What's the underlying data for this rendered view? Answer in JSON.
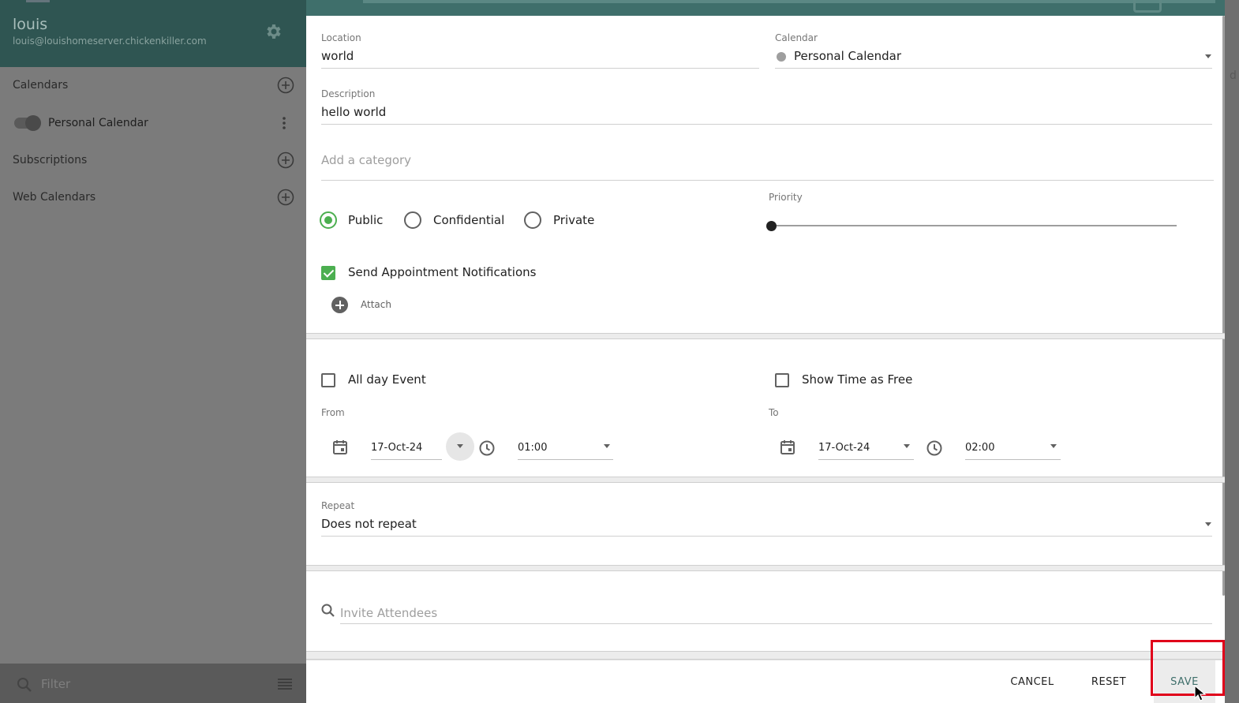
{
  "sidebar": {
    "user_name": "louis",
    "user_email": "louis@louishomeserver.chickenkiller.com",
    "sections": {
      "calendars": "Calendars",
      "personal_calendar": "Personal Calendar",
      "subscriptions": "Subscriptions",
      "web_calendars": "Web Calendars"
    },
    "filter_placeholder": "Filter"
  },
  "dialog": {
    "location": {
      "label": "Location",
      "value": "world"
    },
    "calendar": {
      "label": "Calendar",
      "value": "Personal Calendar"
    },
    "description": {
      "label": "Description",
      "value": "hello world"
    },
    "category_placeholder": "Add a category",
    "visibility": {
      "public": "Public",
      "confidential": "Confidential",
      "private": "Private",
      "selected": "public"
    },
    "priority": {
      "label": "Priority",
      "value": 0
    },
    "send_notifications": {
      "label": "Send Appointment Notifications",
      "checked": true
    },
    "attach_label": "Attach",
    "all_day": {
      "label": "All day Event",
      "checked": false
    },
    "show_free": {
      "label": "Show Time as Free",
      "checked": false
    },
    "from": {
      "label": "From",
      "date": "17-Oct-24",
      "time": "01:00"
    },
    "to": {
      "label": "To",
      "date": "17-Oct-24",
      "time": "02:00"
    },
    "repeat": {
      "label": "Repeat",
      "value": "Does not repeat"
    },
    "invite_placeholder": "Invite Attendees",
    "buttons": {
      "cancel": "CANCEL",
      "reset": "RESET",
      "save": "SAVE"
    }
  },
  "colors": {
    "accent": "#4caf50",
    "header": "#3f6f6b",
    "highlight": "#e0001a"
  }
}
